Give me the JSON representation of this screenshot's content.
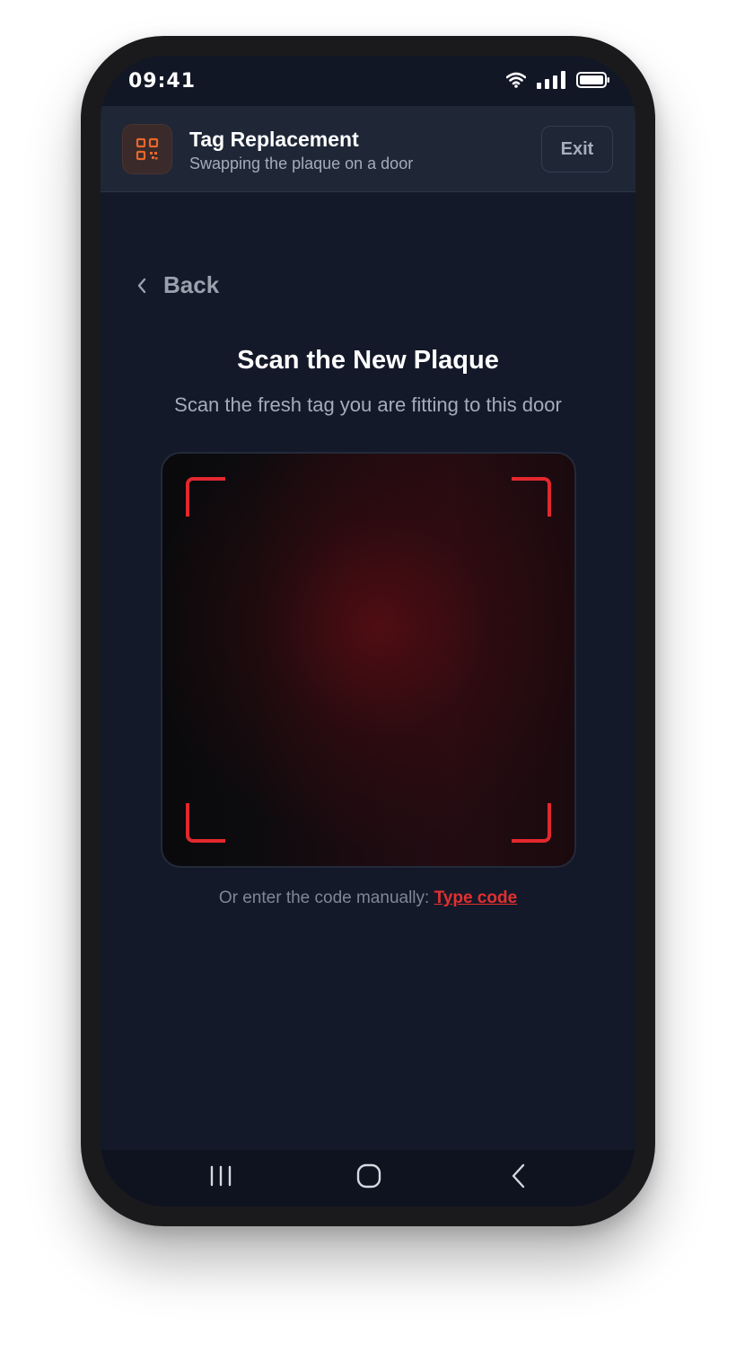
{
  "status_bar": {
    "time": "09:41",
    "icons": [
      "wifi-icon",
      "signal-icon",
      "battery-icon"
    ]
  },
  "header": {
    "app_icon": "qr-code-icon",
    "title": "Tag Replacement",
    "subtitle": "Swapping the plaque on a door",
    "exit_label": "Exit"
  },
  "back": {
    "icon": "chevron-left-icon",
    "label": "Back"
  },
  "main": {
    "title": "Scan the New Plaque",
    "subtitle": "Scan the fresh tag you are fitting to this door",
    "manual_prefix": "Or enter the code manually:",
    "manual_link": "Type code"
  },
  "navbar": {
    "icons": [
      "recent-apps-icon",
      "home-icon",
      "back-nav-icon"
    ]
  },
  "colors": {
    "accent": "#e2282e",
    "qr_icon": "#e8672a",
    "background": "#141929",
    "header_bg": "#1f2737"
  }
}
